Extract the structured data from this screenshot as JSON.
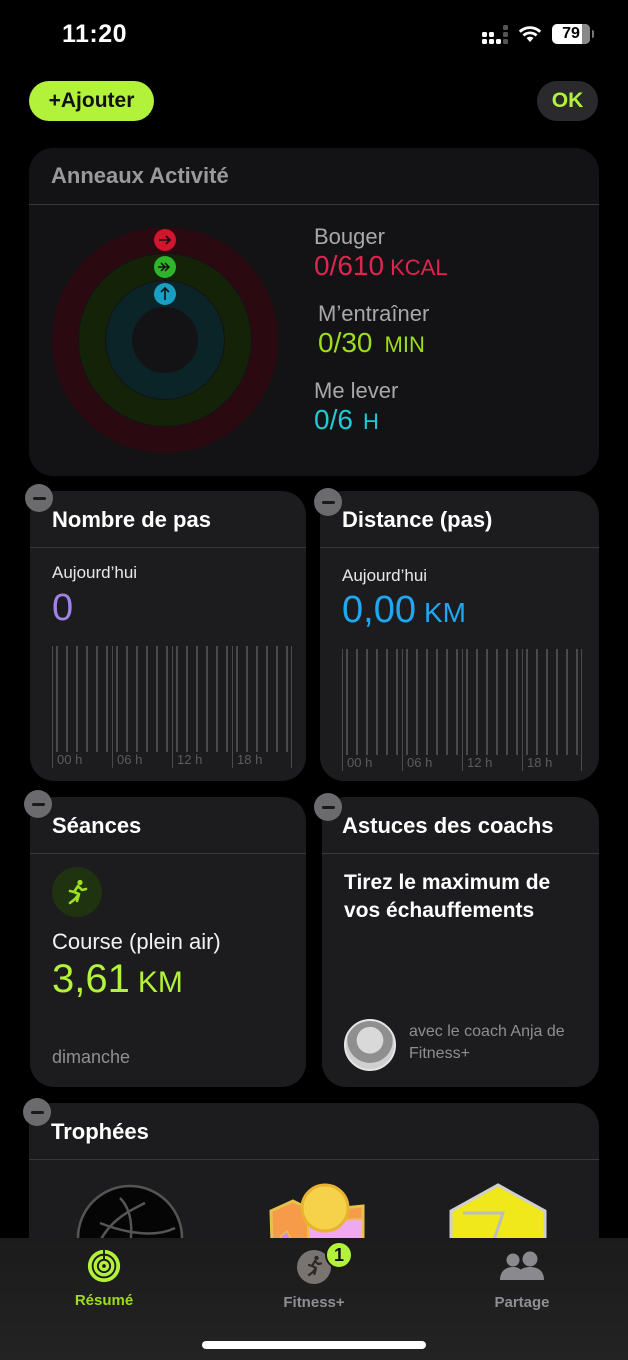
{
  "status_bar": {
    "time": "11:20",
    "battery_level": "79",
    "signal_icon": "cellular-signal-icon",
    "wifi_icon": "wifi-icon"
  },
  "header": {
    "add_label": "+Ajouter",
    "ok_label": "OK"
  },
  "colors": {
    "accent": "#b3f23a",
    "move": "#e0244f",
    "exercise": "#9fdc1c",
    "stand": "#1ecad3",
    "steps": "#9f83e6",
    "distance": "#1fa8f0"
  },
  "activity_rings": {
    "title": "Anneaux Activité",
    "move": {
      "label": "Bouger",
      "value": "0/610",
      "unit": "KCAL",
      "progress": 0,
      "icon": "arrow-right-icon"
    },
    "exercise": {
      "label": "M’entraîner",
      "value": "0/30",
      "unit": "MIN",
      "progress": 0,
      "icon": "double-arrow-right-icon"
    },
    "stand": {
      "label": "Me lever",
      "value": "0/6",
      "unit": "H",
      "progress": 0,
      "icon": "arrow-up-icon"
    }
  },
  "steps_card": {
    "title": "Nombre de pas",
    "subtitle": "Aujourd’hui",
    "value": "0",
    "axis_labels": [
      "00 h",
      "06 h",
      "12 h",
      "18 h"
    ],
    "hourly_values": [
      0,
      0,
      0,
      0,
      0,
      0,
      0,
      0,
      0,
      0,
      0,
      0,
      0,
      0,
      0,
      0,
      0,
      0,
      0,
      0,
      0,
      0,
      0,
      0
    ]
  },
  "distance_card": {
    "title": "Distance (pas)",
    "subtitle": "Aujourd’hui",
    "value": "0,00",
    "unit": "KM",
    "axis_labels": [
      "00 h",
      "06 h",
      "12 h",
      "18 h"
    ],
    "hourly_values": [
      0,
      0,
      0,
      0,
      0,
      0,
      0,
      0,
      0,
      0,
      0,
      0,
      0,
      0,
      0,
      0,
      0,
      0,
      0,
      0,
      0,
      0,
      0,
      0
    ]
  },
  "workouts_card": {
    "title": "Séances",
    "workout_name": "Course (plein air)",
    "value": "3,61",
    "unit": "KM",
    "day": "dimanche",
    "icon": "running-figure-icon"
  },
  "coach_tips_card": {
    "title": "Astuces des coachs",
    "tip": "Tirez le maximum de vos échauffements",
    "coach": "avec le coach Anja de Fitness+"
  },
  "trophies_card": {
    "title": "Trophées",
    "awards": [
      "dark-circle-award-icon",
      "colorful-badge-award-icon",
      "yellow-hexagon-7-award-icon"
    ]
  },
  "tabbar": {
    "tabs": [
      {
        "label": "Résumé",
        "icon": "activity-rings-icon",
        "active": true
      },
      {
        "label": "Fitness+",
        "icon": "fitness-plus-icon",
        "active": false,
        "badge": "1"
      },
      {
        "label": "Partage",
        "icon": "people-icon",
        "active": false
      }
    ]
  }
}
